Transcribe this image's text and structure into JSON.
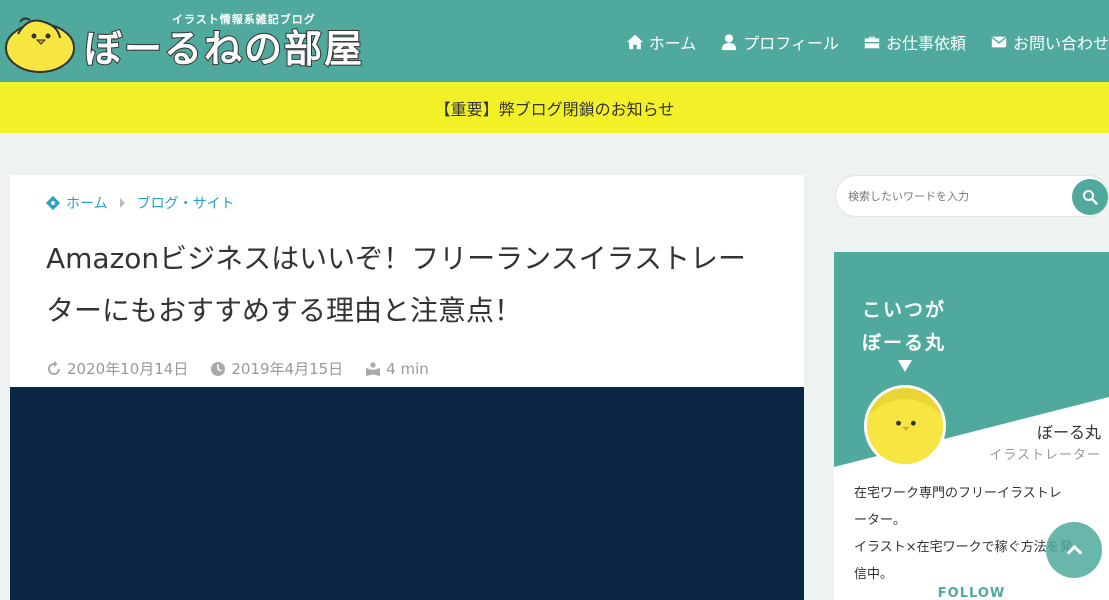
{
  "header": {
    "subtitle": "イラスト情報系雑記ブログ",
    "title": "ぼーるねの部屋",
    "nav": [
      {
        "label": "ホーム",
        "icon": "home-icon"
      },
      {
        "label": "プロフィール",
        "icon": "user-icon"
      },
      {
        "label": "お仕事依頼",
        "icon": "briefcase-icon"
      },
      {
        "label": "お問い合わせ",
        "icon": "envelope-icon"
      }
    ]
  },
  "notice": {
    "text": "【重要】弊ブログ閉鎖のお知らせ"
  },
  "breadcrumb": {
    "home": "ホーム",
    "category": "ブログ・サイト"
  },
  "article": {
    "title": "Amazonビジネスはいいぞ！フリーランスイラストレーターにもおすすめする理由と注意点！",
    "updated": "2020年10月14日",
    "published": "2019年4月15日",
    "read_time": "4 min"
  },
  "sidebar": {
    "search_placeholder": "検索したいワードを入力",
    "profile": {
      "catch_line1": "こいつが",
      "catch_line2": "ぼーる丸",
      "name": "ぼーる丸",
      "role": "イラストレーター",
      "desc_line1": "在宅ワーク専門のフリーイラストレ",
      "desc_line2": "ーター。",
      "desc_line3": "イラスト×在宅ワークで稼ぐ方法を発",
      "desc_line4": "信中。",
      "follow": "FOLLOW"
    }
  },
  "colors": {
    "header": "#4fa99c",
    "notice": "#f2f026",
    "link": "#2aa0c8",
    "eyecatch": "#0b2544"
  }
}
